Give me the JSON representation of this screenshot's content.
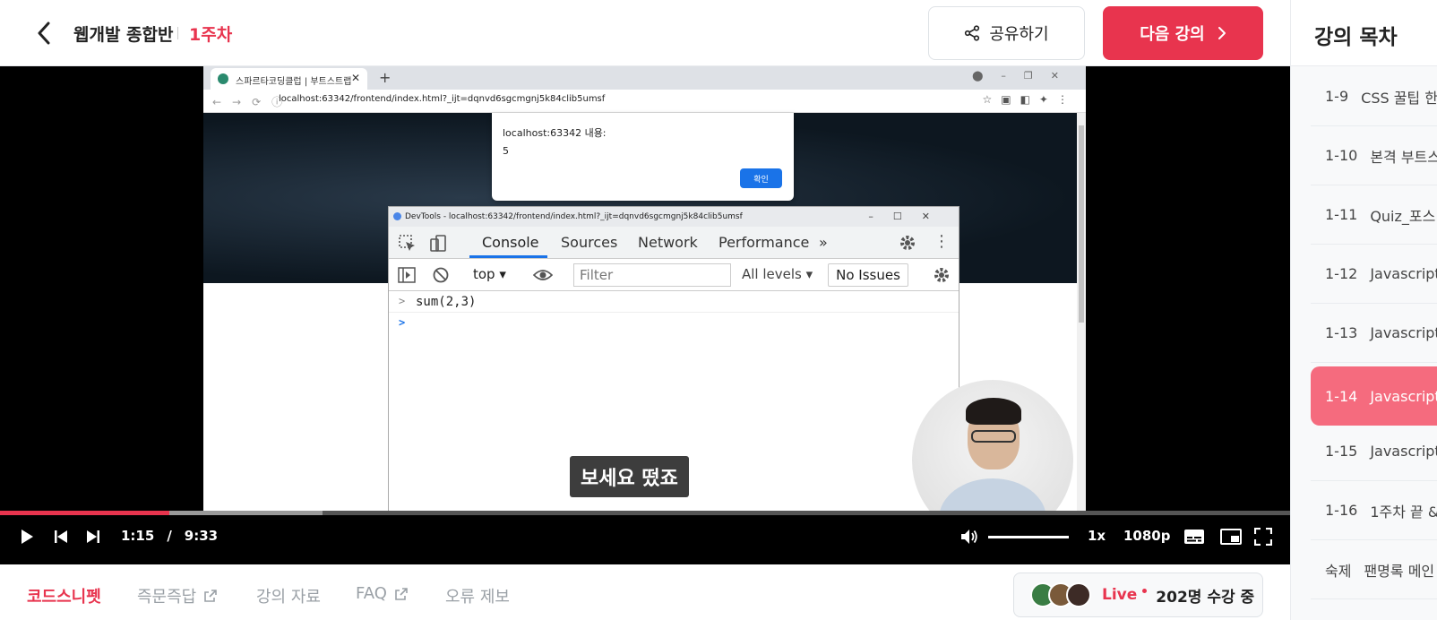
{
  "header": {
    "course_title": "웹개발 종합반",
    "week_label": "1주차",
    "share_label": "공유하기",
    "next_label": "다음 강의"
  },
  "sidebar": {
    "title": "강의 목차",
    "items": [
      {
        "num": "1-9",
        "label": "CSS 꿀팁 한",
        "active": false
      },
      {
        "num": "1-10",
        "label": "본격 부트스",
        "active": false
      },
      {
        "num": "1-11",
        "label": "Quiz_포스팅",
        "active": false
      },
      {
        "num": "1-12",
        "label": "Javascript",
        "active": false
      },
      {
        "num": "1-13",
        "label": "Javascript",
        "active": false
      },
      {
        "num": "1-14",
        "label": "Javascript",
        "active": true
      },
      {
        "num": "1-15",
        "label": "Javascript",
        "active": false
      },
      {
        "num": "1-16",
        "label": "1주차 끝 &",
        "active": false
      },
      {
        "num": "숙제",
        "label": "팬명록 메인",
        "active": false
      }
    ]
  },
  "browser": {
    "tab_title": "스파르타코딩클럽 | 부트스트랩",
    "url": "localhost:63342/frontend/index.html?_ijt=dqnvd6sgcmgnj5k84clib5umsf"
  },
  "alert": {
    "title": "localhost:63342 내용:",
    "message": "5",
    "ok_label": "확인"
  },
  "devtools": {
    "window_title": "DevTools - localhost:63342/frontend/index.html?_ijt=dqnvd6sgcmgnj5k84clib5umsf",
    "tabs": [
      "Console",
      "Sources",
      "Network",
      "Performance"
    ],
    "context": "top",
    "filter_placeholder": "Filter",
    "levels": "All levels",
    "issues": "No Issues",
    "console_lines": [
      "sum(2,3)",
      ""
    ]
  },
  "video": {
    "subtitle": "보세요 떴죠",
    "current_time": "1:15",
    "duration": "9:33",
    "played_fraction": 0.131,
    "buffered_fraction": 0.25,
    "speed": "1x",
    "quality": "1080p",
    "volume_fraction": 1.0
  },
  "bottom": {
    "tabs": [
      {
        "label": "코드스니펫",
        "external": false,
        "active": true
      },
      {
        "label": "즉문즉답",
        "external": true,
        "active": false
      },
      {
        "label": "강의 자료",
        "external": false,
        "active": false
      },
      {
        "label": "FAQ",
        "external": true,
        "active": false
      },
      {
        "label": "오류 제보",
        "external": false,
        "active": false
      }
    ],
    "live_label": "Live",
    "live_count": "202명 수강 중"
  },
  "colors": {
    "accent": "#e8344e",
    "active_item": "#f56b7e",
    "devtools_blue": "#1a73e8"
  }
}
